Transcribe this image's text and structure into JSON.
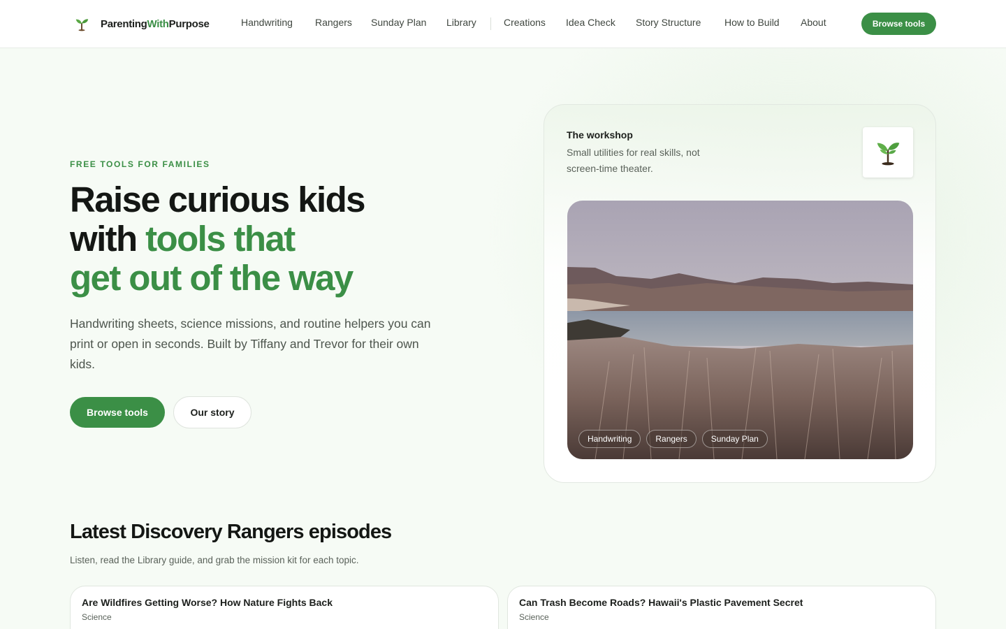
{
  "header": {
    "logo": {
      "prefix": "Parenting",
      "accent": "With",
      "suffix": "Purpose"
    },
    "nav": [
      {
        "label": "Handwriting",
        "key": "handwriting"
      },
      {
        "label": "Rangers",
        "key": "rangers"
      },
      {
        "label": "Sunday Plan",
        "key": "sunday-plan"
      },
      {
        "label": "Library",
        "key": "library"
      },
      {
        "label": "Creations",
        "key": "creations"
      },
      {
        "label": "Idea Check",
        "key": "idea-check"
      },
      {
        "label": "Story Structure",
        "key": "story-structure"
      },
      {
        "label": "How to Build",
        "key": "how-to-build"
      },
      {
        "label": "About",
        "key": "about"
      }
    ],
    "cta_label": "Browse tools"
  },
  "hero": {
    "eyebrow": "FREE TOOLS FOR FAMILIES",
    "title_line1": "Raise curious kids",
    "title_line2_plain": "with ",
    "title_line2_accent": "tools that",
    "title_line3_accent": "get out of the way",
    "subtitle": "Handwriting sheets, science missions, and routine helpers you can print or open in seconds. Built by Tiffany and Trevor for their own kids.",
    "primary_label": "Browse tools",
    "secondary_label": "Our story"
  },
  "workshop": {
    "title": "The workshop",
    "description": "Small utilities for real skills, not screen-time theater.",
    "chips": [
      "Handwriting",
      "Rangers",
      "Sunday Plan"
    ]
  },
  "episodes": {
    "title": "Latest Discovery Rangers episodes",
    "subtitle": "Listen, read the Library guide, and grab the mission kit for each topic.",
    "items": [
      {
        "title": "Are Wildfires Getting Worse? How Nature Fights Back",
        "tag": "Science"
      },
      {
        "title": "Can Trash Become Roads? Hawaii's Plastic Pavement Secret",
        "tag": "Science"
      }
    ]
  },
  "colors": {
    "brand": "#3b8f46",
    "text": "#141714",
    "muted": "#5a625a",
    "bg": "#f6fbf5"
  }
}
